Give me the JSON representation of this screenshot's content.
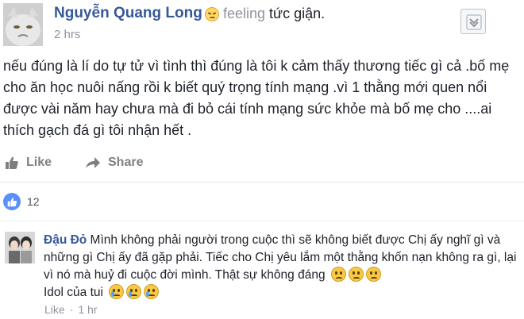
{
  "post": {
    "author": "Nguyễn Quang Long",
    "feeling_label": "feeling",
    "feeling_activity": "tức giận.",
    "timestamp": "2 hrs",
    "body": "nếu đúng là lí do tự tử vì tình thì đúng là tôi k cảm thấy thương tiếc gì cả .bố mẹ cho ăn học nuôi nấng rồi k biết quý trọng tính mạng .vì 1 thằng mới quen nổi được vài năm hay chưa mà đi bỏ cái tính mạng sức khỏe mà bố mẹ cho ....ai thích gạch đá gì tôi nhận hết ."
  },
  "actions": {
    "like": "Like",
    "share": "Share"
  },
  "reactions": {
    "count": "12"
  },
  "comment": {
    "author": "Đậu Đỏ",
    "text_main": " Mình không phải người trong cuộc thì sẽ không biết được Chị ấy nghĩ gì và những gì Chị ấy đã gặp phải. Tiếc cho Chị yêu lắm một thằng khốn nạn không ra gì, lại vì nó mà huỷ đi cuộc đời mình. Thật sự không đáng ",
    "text_tail": "Idol của tui ",
    "like_label": "Like",
    "time": "1 hr"
  },
  "colors": {
    "link": "#365899",
    "muted": "#90949c",
    "text": "#1d2129",
    "like_blue": "#5890ff"
  },
  "icons": {
    "options": "chevron-down-icon",
    "like": "thumbs-up-icon",
    "share": "share-arrow-icon",
    "reaction": "like-reaction-icon",
    "feeling": "angry-face-icon"
  }
}
